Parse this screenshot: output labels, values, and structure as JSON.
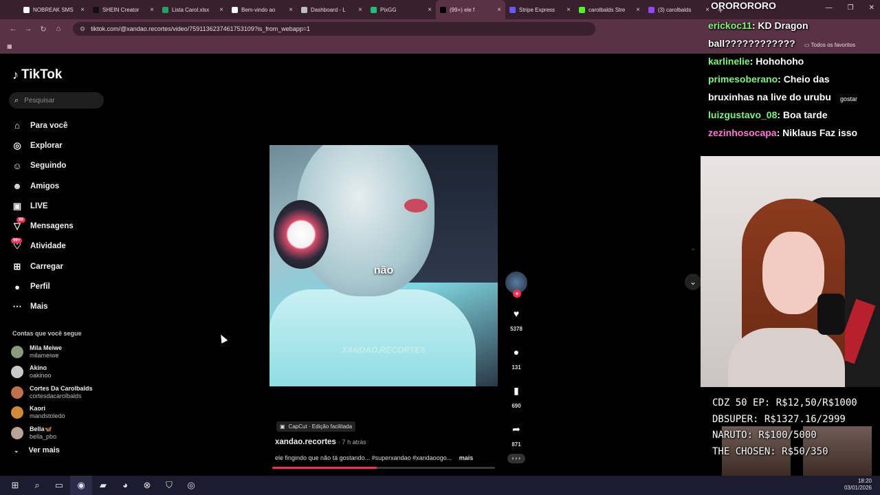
{
  "browser": {
    "tabs": [
      {
        "label": "NOBREAK SMS",
        "icon": "nobreak-icon",
        "color": "#ffffff"
      },
      {
        "label": "SHEIN Creator",
        "icon": "shein-icon",
        "color": "#111111"
      },
      {
        "label": "Lista Carol.xlsx",
        "icon": "excel-icon",
        "color": "#21a366"
      },
      {
        "label": "Bem-vindo ao",
        "icon": "notion-icon",
        "color": "#ffffff"
      },
      {
        "label": "Dashboard - L",
        "icon": "dashboard-icon",
        "color": "#bdbdbd"
      },
      {
        "label": "PixGG",
        "icon": "pixgg-icon",
        "color": "#19c37d"
      },
      {
        "label": "(99+) ele f",
        "icon": "tiktok-icon",
        "color": "#000000"
      },
      {
        "label": "Stripe Express",
        "icon": "stripe-icon",
        "color": "#635bff"
      },
      {
        "label": "carolbalds Stre",
        "icon": "kick-icon",
        "color": "#53fc18"
      },
      {
        "label": "(3) carolbalds",
        "icon": "twitch-icon",
        "color": "#9146ff"
      }
    ],
    "new_tab": "+",
    "url": "tiktok.com/@xandao.recortes/video/7591136237461753109?is_from_webapp=1",
    "bookmarks_all": "Todos os favoritos"
  },
  "tiktok": {
    "logo": "TikTok",
    "search_placeholder": "Pesquisar",
    "nav": [
      {
        "label": "Para você",
        "icon": "home-icon"
      },
      {
        "label": "Explorar",
        "icon": "compass-icon"
      },
      {
        "label": "Seguindo",
        "icon": "following-icon"
      },
      {
        "label": "Amigos",
        "icon": "friends-icon"
      },
      {
        "label": "LIVE",
        "icon": "live-icon"
      },
      {
        "label": "Mensagens",
        "icon": "messages-icon",
        "badge": "98"
      },
      {
        "label": "Atividade",
        "icon": "activity-icon",
        "badge": "99+"
      },
      {
        "label": "Carregar",
        "icon": "upload-icon"
      },
      {
        "label": "Perfil",
        "icon": "profile-icon"
      },
      {
        "label": "Mais",
        "icon": "more-icon"
      }
    ],
    "following_title": "Contas que você segue",
    "following": [
      {
        "name": "Mila Meiwe",
        "handle": "milameiwe",
        "color": "#8a9a7a"
      },
      {
        "name": "Akino",
        "handle": "oakinoo",
        "color": "#c9c9c9"
      },
      {
        "name": "Cortes Da Carolbalds",
        "handle": "cortesdacarolbalds",
        "color": "#c0704a"
      },
      {
        "name": "Kaori",
        "handle": "mandstoledo",
        "color": "#d28a3a"
      },
      {
        "name": "Bella🦋",
        "handle": "bella_pbo",
        "color": "#b9a397"
      }
    ],
    "see_more": "Ver mais",
    "video": {
      "caption_overlay": "não",
      "watermark": "XANDAO.RECORTES",
      "capcut": "CapCut · Edição facilitada",
      "author": "xandao.recortes",
      "time_ago": "· 7 h atrás",
      "description": "ele fingindo que não tá gostando... #superxandao #xandaoogo...",
      "more": "mais",
      "progress": 0.47
    },
    "actions": {
      "likes": "5378",
      "comments": "131",
      "saves": "690",
      "shares": "871"
    }
  },
  "stream": {
    "top_text": "ORORORORO",
    "chat": [
      {
        "user": "erickoc11",
        "msg": ": KD Dragon"
      },
      {
        "user": "",
        "msg": "ball????????????"
      },
      {
        "user": "karlinelie",
        "msg": ": Hohohoho"
      },
      {
        "user": "primesoberano",
        "msg": ": Cheio das"
      },
      {
        "user": "",
        "msg": "bruxinhas na live do urubu"
      },
      {
        "user": "luizgustavo_08",
        "msg": ": Boa tarde"
      },
      {
        "user": "zezinhosocapa",
        "msg": ": Niklaus Faz isso",
        "pink": true
      }
    ],
    "ghost_text": "gostar",
    "goals": [
      "CDZ 50 EP: R$12,50/R$1000",
      "DBSUPER: R$1327.16/2999",
      "NARUTO: R$100/5000",
      "THE CHOSEN: R$50/350"
    ]
  },
  "taskbar": {
    "time": "18:20",
    "date": "03/01/2026"
  }
}
